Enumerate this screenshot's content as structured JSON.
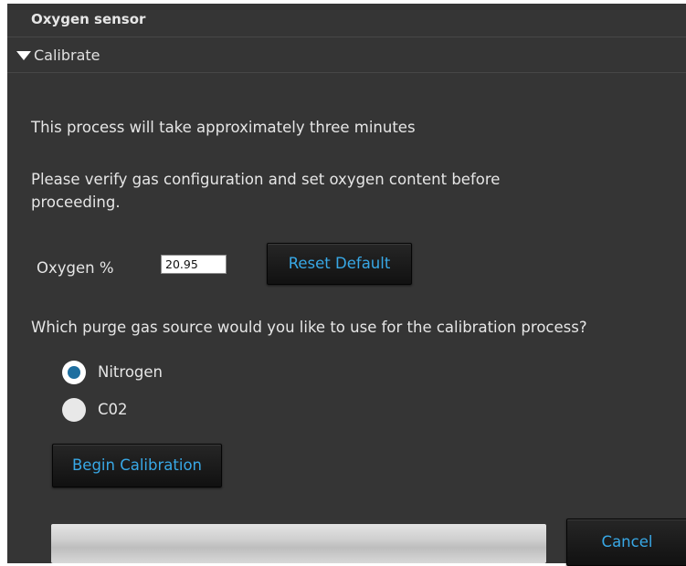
{
  "panel": {
    "title": "Oxygen sensor"
  },
  "section": {
    "label": "Calibrate"
  },
  "info": {
    "duration_text": "This process will take approximately three minutes",
    "verify_line1": "Please verify gas configuration and set oxygen content before",
    "verify_line2": "proceeding."
  },
  "oxygen": {
    "label": "Oxygen %",
    "value": "20.95",
    "reset_label": "Reset Default"
  },
  "purge": {
    "question": "Which purge gas source would you like to use for the calibration process?",
    "options": [
      {
        "label": "Nitrogen",
        "selected": true
      },
      {
        "label": "C02",
        "selected": false
      }
    ]
  },
  "actions": {
    "begin_label": "Begin Calibration",
    "cancel_label": "Cancel"
  },
  "progress": {
    "fraction": 0
  },
  "colors": {
    "panel_bg": "#353535",
    "accent_text": "#38a8e6",
    "radio_selected": "#1e6fa0"
  },
  "icons": {
    "section_toggle": "triangle-down-icon"
  }
}
